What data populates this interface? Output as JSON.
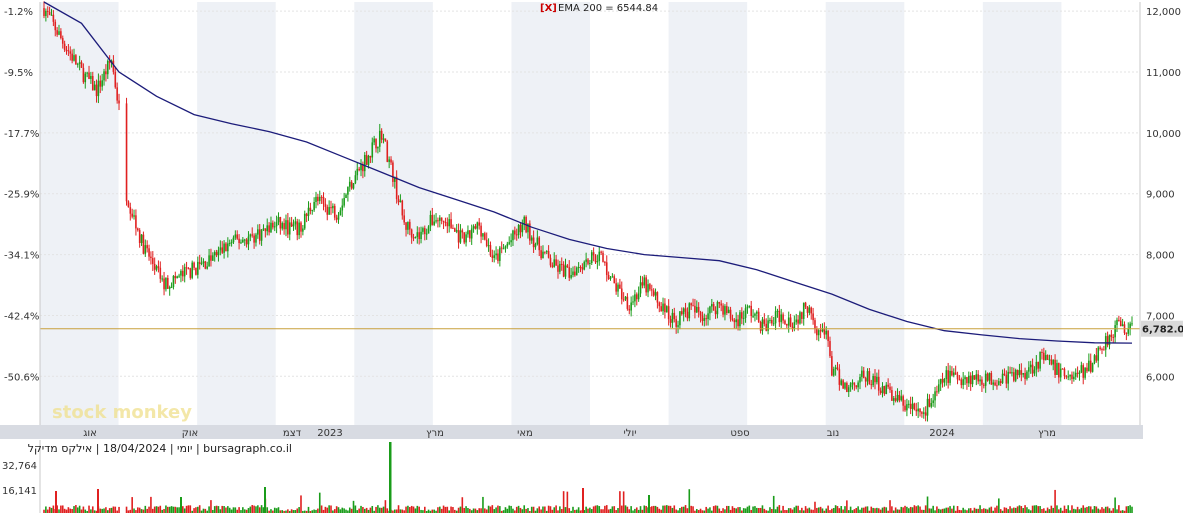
{
  "chart_data": {
    "type": "candlestick",
    "indicator": {
      "label": "EMA 200 = 6544.84",
      "close_marker": "[X]"
    },
    "current_price": {
      "label": "6,782.00",
      "value": 6782
    },
    "info_line": "יומי | 18/04/2024 | אילקס מדיקל | bursagraph.co.il",
    "watermark": "stock monkey",
    "x_ticks": [
      "אוג",
      "אוק",
      "דצמ",
      "2023",
      "מרץ",
      "מאי",
      "יולי",
      "ספט",
      "נוב",
      "2024",
      "מרץ"
    ],
    "y_right_ticks": [
      "12,000",
      "11,000",
      "10,000",
      "9,000",
      "8,000",
      "7,000",
      "6,000"
    ],
    "y_left_ticks": [
      "-1.2%",
      "-9.5%",
      "-17.7%",
      "-25.9%",
      "-34.1%",
      "-42.4%",
      "-50.6%"
    ],
    "volume_ticks": [
      "32,764",
      "16,141"
    ],
    "ylim": [
      5200,
      12150
    ],
    "price_path": [
      [
        0,
        12050
      ],
      [
        5,
        11500
      ],
      [
        10,
        11000
      ],
      [
        14,
        10700
      ],
      [
        18,
        11200
      ],
      [
        20,
        10400
      ],
      [
        22,
        9000
      ],
      [
        26,
        8200
      ],
      [
        32,
        7500
      ],
      [
        38,
        7700
      ],
      [
        44,
        7900
      ],
      [
        50,
        8200
      ],
      [
        56,
        8300
      ],
      [
        62,
        8500
      ],
      [
        68,
        8400
      ],
      [
        72,
        8900
      ],
      [
        78,
        8700
      ],
      [
        82,
        9200
      ],
      [
        86,
        9600
      ],
      [
        90,
        10000
      ],
      [
        93,
        9300
      ],
      [
        96,
        8500
      ],
      [
        100,
        8300
      ],
      [
        104,
        8600
      ],
      [
        108,
        8500
      ],
      [
        112,
        8200
      ],
      [
        116,
        8500
      ],
      [
        120,
        7900
      ],
      [
        124,
        8200
      ],
      [
        128,
        8500
      ],
      [
        132,
        8100
      ],
      [
        136,
        7800
      ],
      [
        140,
        7700
      ],
      [
        144,
        7900
      ],
      [
        148,
        8000
      ],
      [
        152,
        7500
      ],
      [
        156,
        7200
      ],
      [
        160,
        7500
      ],
      [
        164,
        7200
      ],
      [
        168,
        6900
      ],
      [
        172,
        7100
      ],
      [
        176,
        7000
      ],
      [
        180,
        7200
      ],
      [
        184,
        6900
      ],
      [
        188,
        7100
      ],
      [
        192,
        6800
      ],
      [
        196,
        7000
      ],
      [
        200,
        6900
      ],
      [
        204,
        7200
      ],
      [
        206,
        6800
      ],
      [
        209,
        6600
      ],
      [
        210,
        6100
      ],
      [
        214,
        5800
      ],
      [
        218,
        6000
      ],
      [
        222,
        5900
      ],
      [
        226,
        5700
      ],
      [
        230,
        5500
      ],
      [
        234,
        5400
      ],
      [
        238,
        5700
      ],
      [
        240,
        6000
      ],
      [
        246,
        5980
      ],
      [
        252,
        5950
      ],
      [
        258,
        6000
      ],
      [
        262,
        6100
      ],
      [
        266,
        6300
      ],
      [
        270,
        6100
      ],
      [
        274,
        6000
      ],
      [
        278,
        6100
      ],
      [
        282,
        6500
      ],
      [
        286,
        6850
      ],
      [
        290,
        6750
      ]
    ],
    "ema_path": [
      [
        0,
        12150
      ],
      [
        10,
        11800
      ],
      [
        20,
        11000
      ],
      [
        30,
        10600
      ],
      [
        40,
        10300
      ],
      [
        50,
        10150
      ],
      [
        60,
        10020
      ],
      [
        70,
        9850
      ],
      [
        80,
        9600
      ],
      [
        90,
        9350
      ],
      [
        100,
        9100
      ],
      [
        110,
        8900
      ],
      [
        120,
        8700
      ],
      [
        130,
        8450
      ],
      [
        140,
        8250
      ],
      [
        150,
        8100
      ],
      [
        160,
        8000
      ],
      [
        170,
        7950
      ],
      [
        180,
        7900
      ],
      [
        190,
        7750
      ],
      [
        200,
        7550
      ],
      [
        210,
        7350
      ],
      [
        220,
        7100
      ],
      [
        230,
        6900
      ],
      [
        240,
        6750
      ],
      [
        250,
        6680
      ],
      [
        260,
        6620
      ],
      [
        270,
        6580
      ],
      [
        280,
        6550
      ],
      [
        290,
        6545
      ]
    ],
    "x_range": [
      0,
      290
    ],
    "gap": {
      "from": 20,
      "to": 22,
      "from_value": 10400,
      "to_value": 9000
    }
  },
  "colors": {
    "up": "#1a9c1a",
    "down": "#e02020",
    "ema": "#1c1c7a",
    "price_line": "#c8a03c",
    "band": "#eef1f6",
    "axis_bar": "#d8dbe2"
  }
}
